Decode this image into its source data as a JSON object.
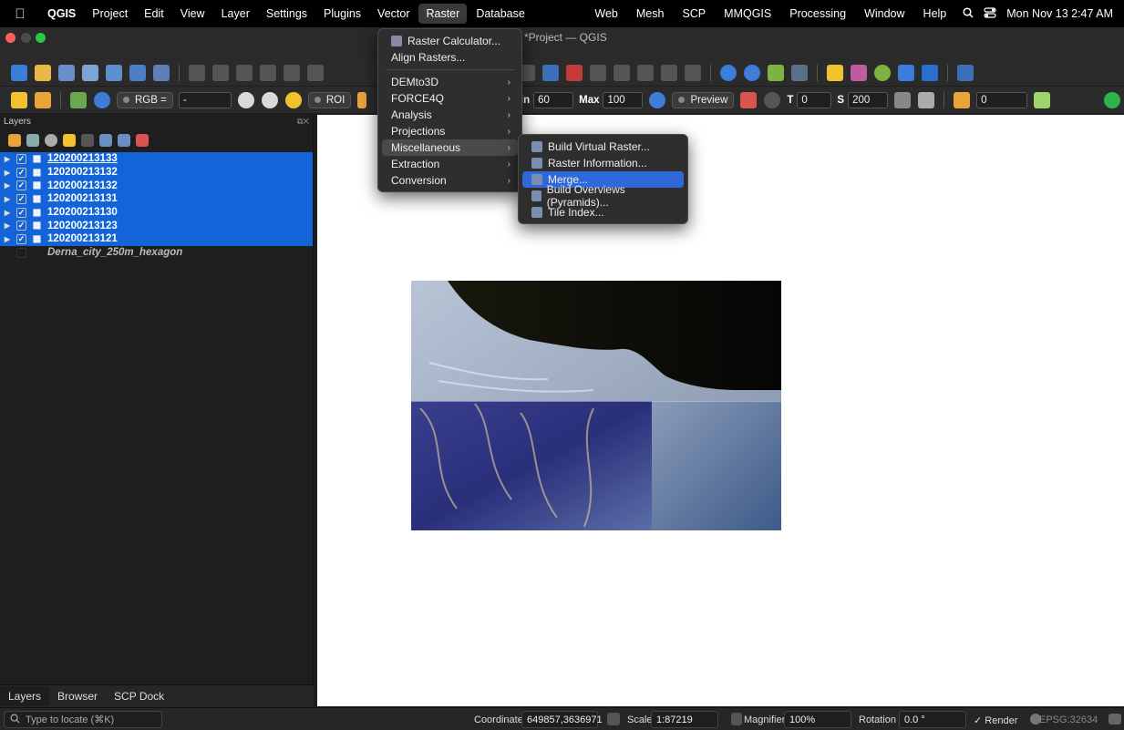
{
  "menubar": {
    "apple": "",
    "app": "QGIS",
    "menus": [
      "Project",
      "Edit",
      "View",
      "Layer",
      "Settings",
      "Plugins",
      "Vector",
      "Raster",
      "Database"
    ],
    "right_menus": [
      "Web",
      "Mesh",
      "SCP",
      "MMQGIS",
      "Processing",
      "Window",
      "Help"
    ],
    "clock": "Mon Nov 13  2:47 AM"
  },
  "window": {
    "title": "*Project — QGIS"
  },
  "toolbar3": {
    "rgb_label": "RGB =",
    "rgb_value": "-",
    "roi_label": "ROI",
    "min_label": "Min",
    "min_value": "60",
    "max_label": "Max",
    "max_value": "100",
    "preview_label": "Preview",
    "t_label": "T",
    "t_value": "0",
    "s_label": "S",
    "s_value": "200",
    "zero_value": "0"
  },
  "layers_panel": {
    "title": "Layers",
    "layers": [
      {
        "name": "120200213133",
        "checked": true
      },
      {
        "name": "120200213132",
        "checked": true
      },
      {
        "name": "120200213132",
        "checked": true
      },
      {
        "name": "120200213131",
        "checked": true
      },
      {
        "name": "120200213130",
        "checked": true
      },
      {
        "name": "120200213123",
        "checked": true
      },
      {
        "name": "120200213121",
        "checked": true
      }
    ],
    "extra_layer": "Derna_city_250m_hexagon",
    "tabs": [
      "Layers",
      "Browser",
      "SCP Dock"
    ]
  },
  "raster_menu": {
    "items": [
      "Raster Calculator...",
      "Align Rasters..."
    ],
    "submenus": [
      "DEMto3D",
      "FORCE4Q",
      "Analysis",
      "Projections",
      "Miscellaneous",
      "Extraction",
      "Conversion"
    ],
    "highlighted": "Miscellaneous"
  },
  "misc_menu": {
    "items": [
      "Build Virtual Raster...",
      "Raster Information...",
      "Merge...",
      "Build Overviews (Pyramids)...",
      "Tile Index..."
    ],
    "highlighted": "Merge..."
  },
  "statusbar": {
    "locate_placeholder": "Type to locate (⌘K)",
    "coordinate_label": "Coordinate",
    "coordinate_value": "649857,3636971",
    "scale_label": "Scale",
    "scale_value": "1:87219",
    "magnifier_label": "Magnifier",
    "magnifier_value": "100%",
    "rotation_label": "Rotation",
    "rotation_value": "0.0 °",
    "render_label": "Render",
    "crs": "EPSG:32634"
  },
  "colors": {
    "selection": "#1464d9",
    "menu_highlight": "#2f69d9",
    "canvas": "#ffffff"
  }
}
